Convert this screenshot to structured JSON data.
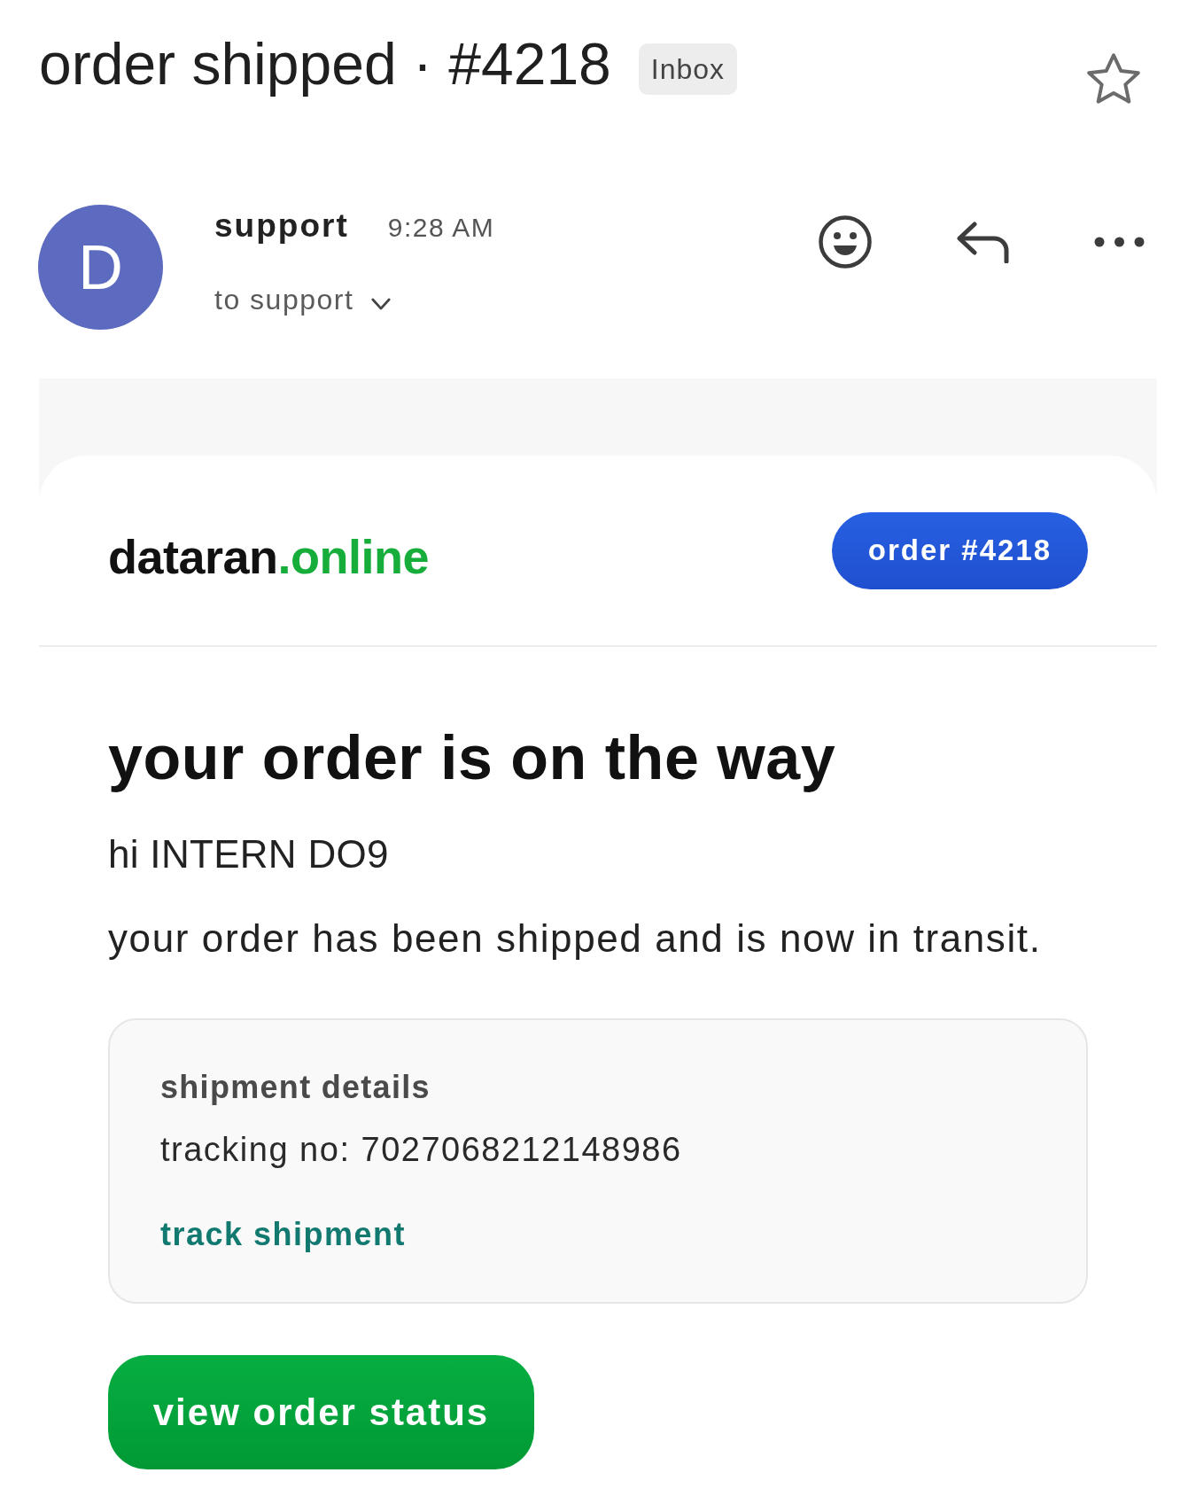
{
  "thread": {
    "subject": "order shipped · #4218",
    "label": "Inbox",
    "starred": false
  },
  "sender": {
    "avatar_letter": "D",
    "name": "support",
    "time": "9:28 AM",
    "recipient": "to support"
  },
  "email_body": {
    "brand": {
      "name": "dataran",
      "domain": ".online"
    },
    "order_badge": "order #4218",
    "heading": "your order is on the way",
    "greeting": "hi INTERN DO9",
    "intro": "your order has been shipped and is now in transit.",
    "shipment": {
      "title": "shipment details",
      "tracking": "tracking no: 7027068212148986",
      "link": "track shipment"
    },
    "cta_button": "view order status"
  }
}
